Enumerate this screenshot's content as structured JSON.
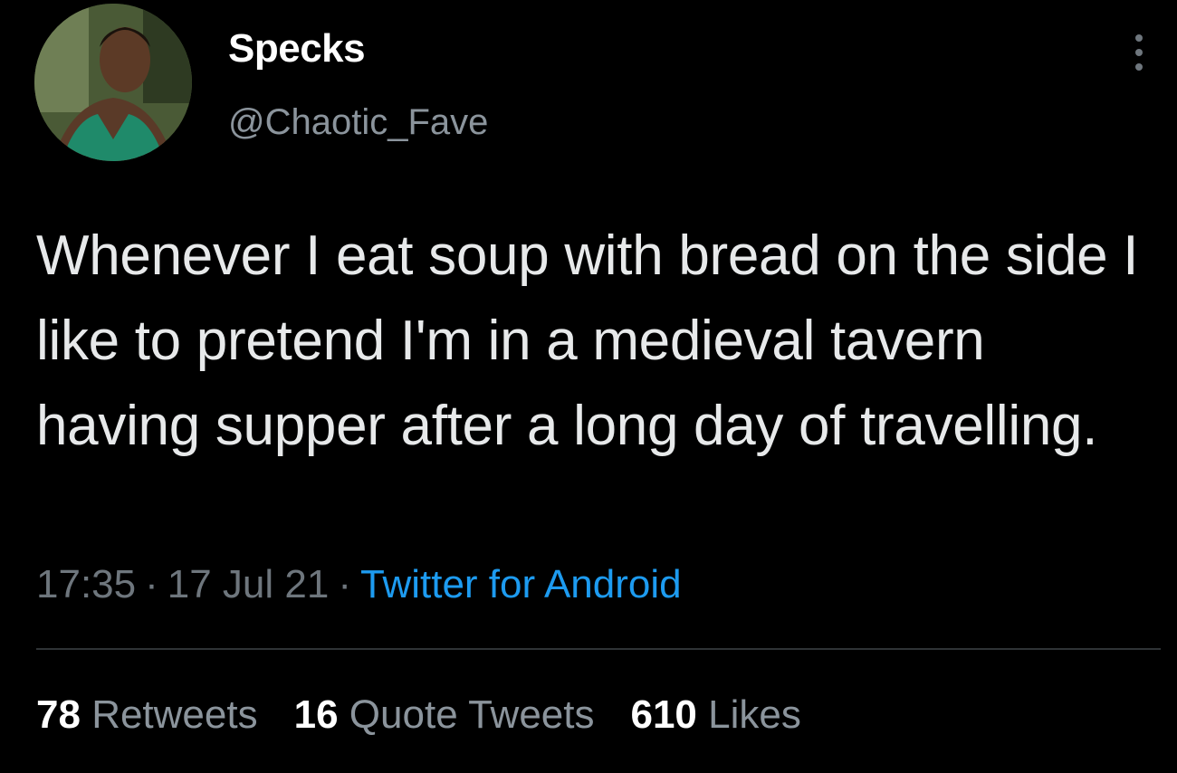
{
  "author": {
    "display_name": "Specks",
    "handle": "@Chaotic_Fave",
    "avatar_icon": "profile-photo"
  },
  "tweet": {
    "text": "Whenever I eat soup with bread on the side I like to pretend I'm in a medieval tavern having supper after a long day of travelling."
  },
  "meta": {
    "time": "17:35",
    "separator": "·",
    "date": "17 Jul 21",
    "source": "Twitter for Android"
  },
  "stats": {
    "retweets": {
      "count": "78",
      "label": "Retweets"
    },
    "quotes": {
      "count": "16",
      "label": "Quote Tweets"
    },
    "likes": {
      "count": "610",
      "label": "Likes"
    }
  },
  "menu": {
    "icon": "more-options-icon"
  },
  "colors": {
    "background": "#000000",
    "text": "#e7e9ea",
    "secondary": "#6e767d",
    "link": "#1d9bf0",
    "divider": "#2f3336"
  }
}
